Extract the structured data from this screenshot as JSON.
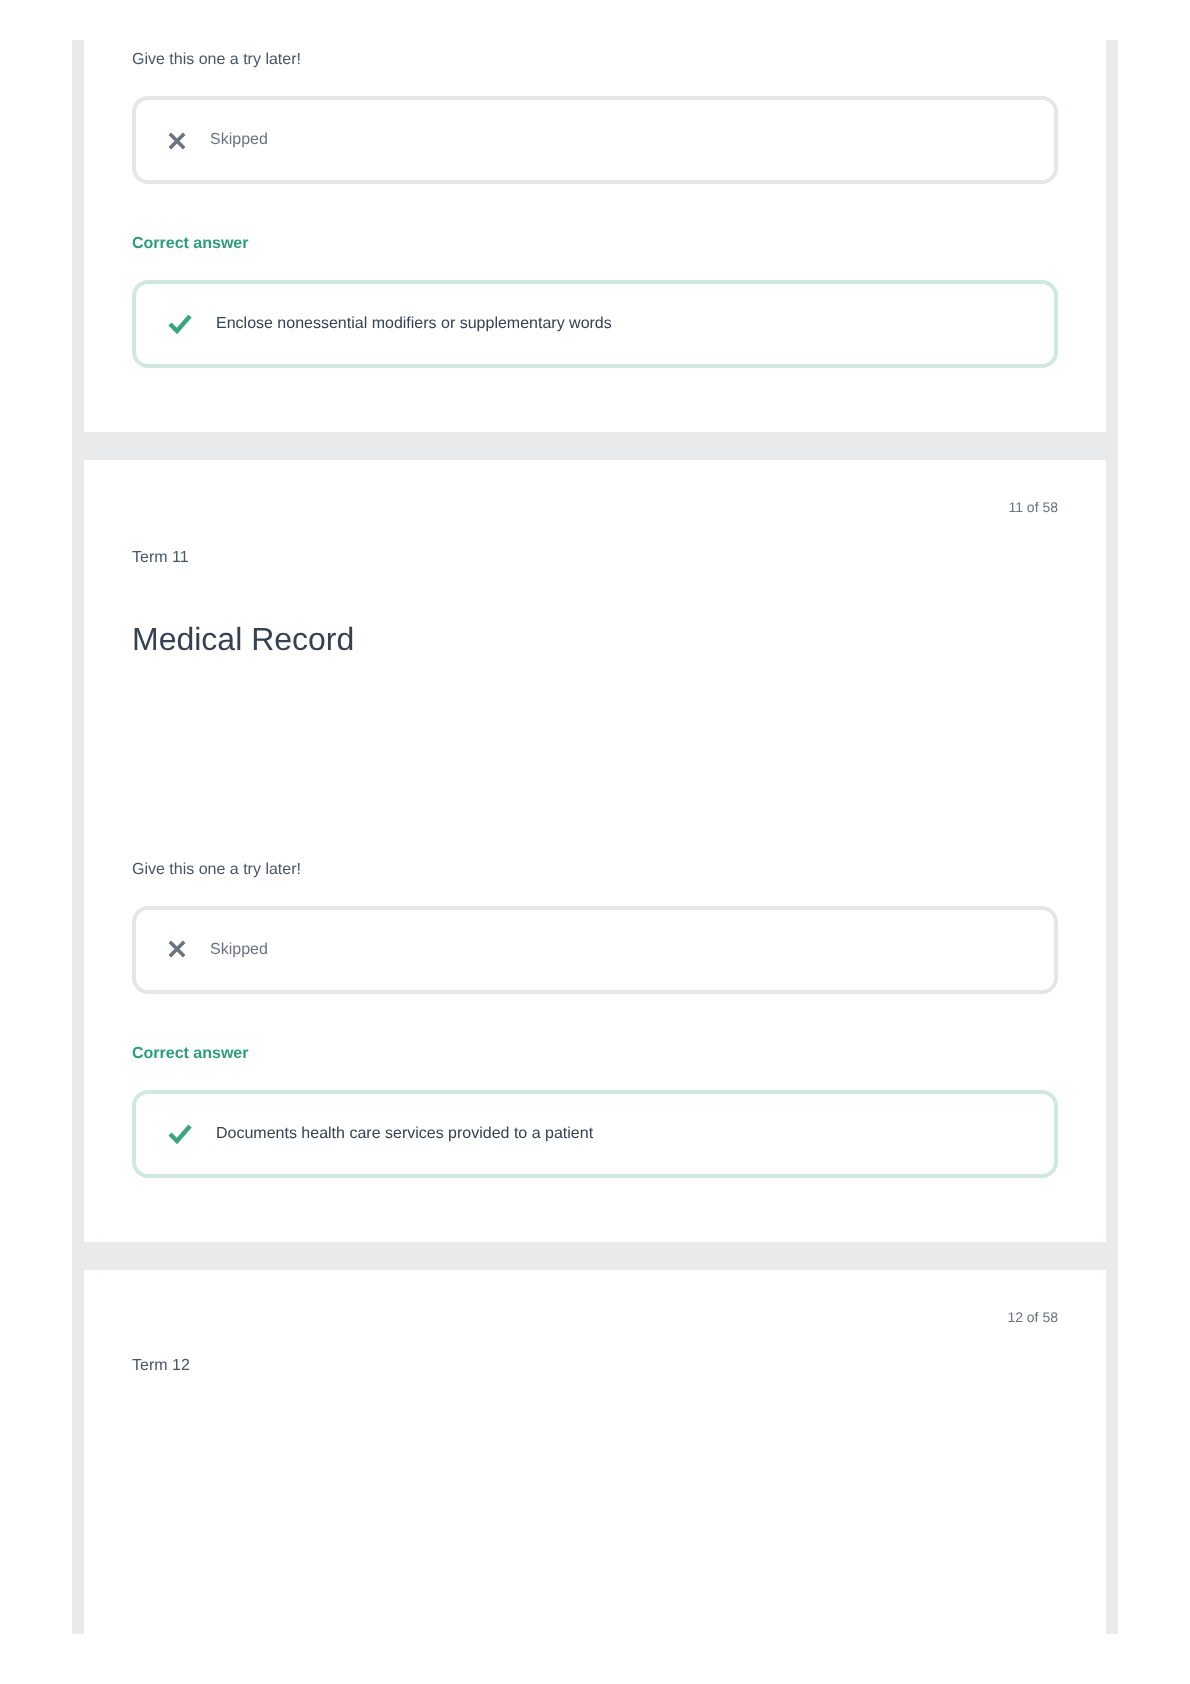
{
  "cards": [
    {
      "prompt": "Give this one a try later!",
      "answer_status": "Skipped",
      "correct_label": "Correct answer",
      "correct_answer": "Enclose nonessential modifiers or supplementary words"
    },
    {
      "counter": "11 of 58",
      "term_label": "Term 11",
      "term": "Medical Record",
      "prompt": "Give this one a try later!",
      "answer_status": "Skipped",
      "correct_label": "Correct answer",
      "correct_answer": "Documents health care services provided to a patient"
    },
    {
      "counter": "12 of 58",
      "term_label": "Term 12"
    }
  ]
}
